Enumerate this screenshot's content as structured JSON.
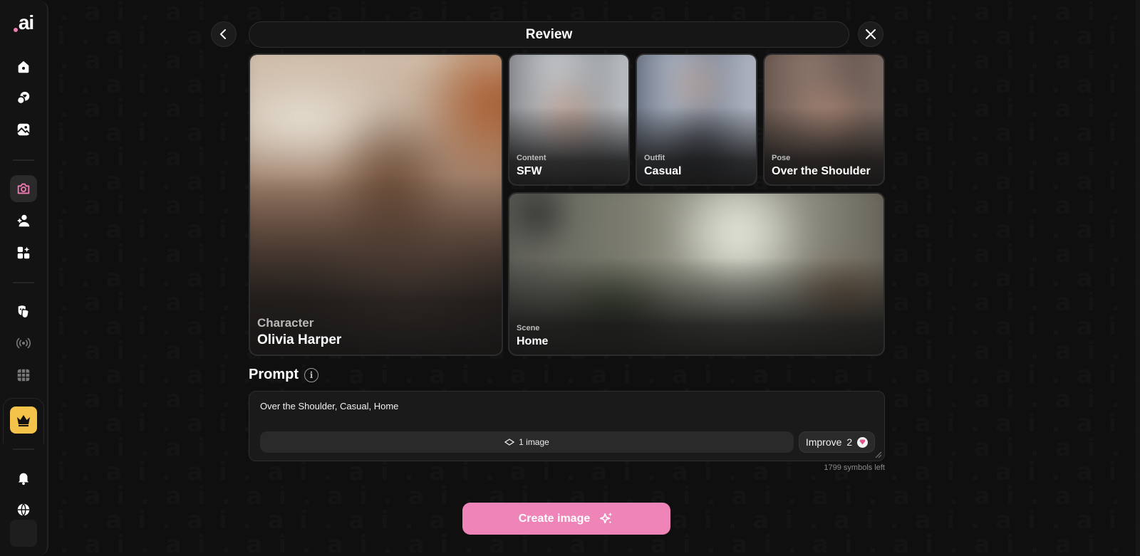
{
  "background_glyph": ".ai",
  "sidebar": {
    "logo_text": "ai",
    "accent_color": "#f07ab4",
    "premium_color": "#f5c24a",
    "items": [
      {
        "icon": "home-icon"
      },
      {
        "icon": "chat-heart-icon"
      },
      {
        "icon": "gallery-icon"
      },
      {
        "icon": "camera-icon",
        "active": true
      },
      {
        "icon": "add-user-icon"
      },
      {
        "icon": "widgets-sparkle-icon"
      },
      {
        "icon": "theater-masks-icon"
      },
      {
        "icon": "broadcast-icon"
      },
      {
        "icon": "grid-icon"
      },
      {
        "icon": "crown-icon"
      },
      {
        "icon": "bell-icon"
      },
      {
        "icon": "globe-icon"
      }
    ]
  },
  "header": {
    "title": "Review"
  },
  "cards": {
    "character": {
      "label": "Character",
      "value": "Olivia Harper"
    },
    "content": {
      "label": "Content",
      "value": "SFW"
    },
    "outfit": {
      "label": "Outfit",
      "value": "Casual"
    },
    "pose": {
      "label": "Pose",
      "value": "Over the Shoulder"
    },
    "scene": {
      "label": "Scene",
      "value": "Home"
    }
  },
  "prompt": {
    "label": "Prompt",
    "text": "Over the Shoulder, Casual, Home",
    "image_count": "1 image",
    "improve_label": "Improve",
    "improve_cost": "2",
    "symbols_left": "1799 symbols left"
  },
  "create_button": {
    "label": "Create image",
    "color": "#ee84b8"
  }
}
